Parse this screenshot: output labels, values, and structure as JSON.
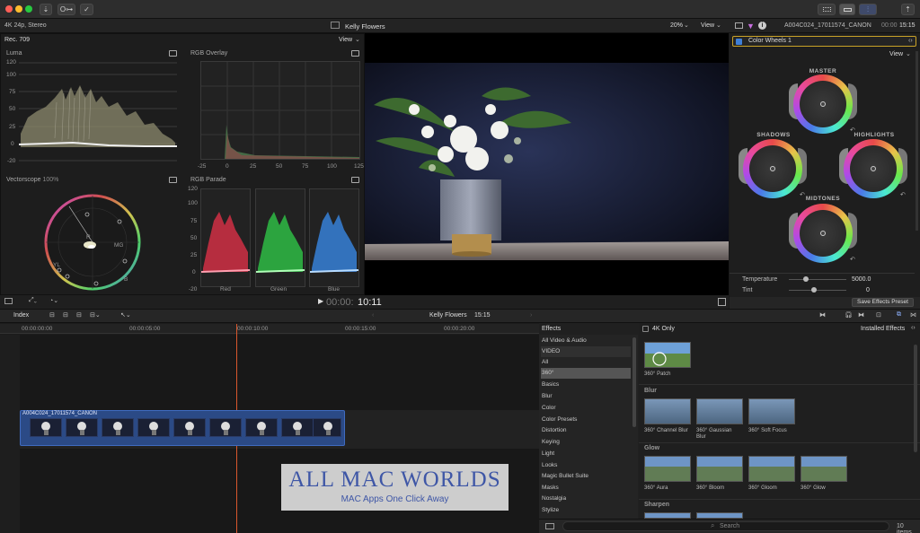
{
  "toolbar": {
    "btn1": "⇣",
    "btn2": "O⊶",
    "btn3": "✓"
  },
  "sub_header": {
    "format": "4K 24p, Stereo",
    "project": "Kelly Flowers",
    "zoom": "20%",
    "view": "View",
    "clip_name": "A004C024_17011574_CANON",
    "timecode_dim": "00:00",
    "timecode": "15:15"
  },
  "scopes": {
    "rec": "Rec. 709",
    "view": "View",
    "luma_title": "Luma",
    "luma_ticks": [
      "120",
      "100",
      "75",
      "50",
      "25",
      "0",
      "-20"
    ],
    "rgb_overlay_title": "RGB Overlay",
    "rgb_overlay_xticks": [
      "-25",
      "0",
      "25",
      "50",
      "75",
      "100",
      "125"
    ],
    "vectorscope_title": "Vectorscope",
    "vectorscope_pct": "100%",
    "vec_labels": [
      "R",
      "MG",
      "YL",
      "B",
      "G",
      "CY"
    ],
    "rgb_parade_title": "RGB Parade",
    "parade_ticks": [
      "120",
      "100",
      "75",
      "50",
      "25",
      "0",
      "-20"
    ],
    "parade_labels": [
      "Red",
      "Green",
      "Blue"
    ]
  },
  "viewer": {
    "timecode_dim": "00:00:",
    "timecode": "10:11"
  },
  "inspector": {
    "effect": "Color Wheels 1",
    "view": "View",
    "wheels": [
      "MASTER",
      "SHADOWS",
      "HIGHLIGHTS",
      "MIDTONES"
    ],
    "temperature_label": "Temperature",
    "temperature_value": "5000.0",
    "tint_label": "Tint",
    "tint_value": "0",
    "save_preset": "Save Effects Preset"
  },
  "timeline": {
    "index": "Index",
    "project": "Kelly Flowers",
    "duration": "15:15",
    "ruler": [
      "00:00:00:00",
      "00:00:05:00",
      "00:00:10:00",
      "00:00:15:00",
      "00:00:20:00"
    ],
    "clip_name": "A004C024_17011574_CANON"
  },
  "effects": {
    "header": "Effects",
    "categories": [
      "All Video & Audio",
      "VIDEO",
      "All",
      "360°",
      "Basics",
      "Blur",
      "Color",
      "Color Presets",
      "Distortion",
      "Keying",
      "Light",
      "Looks",
      "Magic Bullet Suite",
      "Masks",
      "Nostalgia",
      "Stylize"
    ],
    "selected": "360°",
    "filter_label": "4K Only",
    "installed": "Installed Effects",
    "sections": [
      "Blur",
      "Glow",
      "Sharpen"
    ],
    "patch_label": "360° Patch",
    "blur_items": [
      "360° Channel Blur",
      "360° Gaussian Blur",
      "360° Soft Focus"
    ],
    "glow_items": [
      "360° Aura",
      "360° Bloom",
      "360° Gloom",
      "360° Glow"
    ],
    "search_placeholder": "Search",
    "count": "10 items"
  },
  "watermark": {
    "brand": "ALL MAC WORLDS",
    "tagline": "MAC Apps One Click Away"
  },
  "colors": {
    "accent": "#3f7fd6",
    "playhead": "#d9572d",
    "clip": "#2b4a86",
    "selected_row": "#555555"
  }
}
